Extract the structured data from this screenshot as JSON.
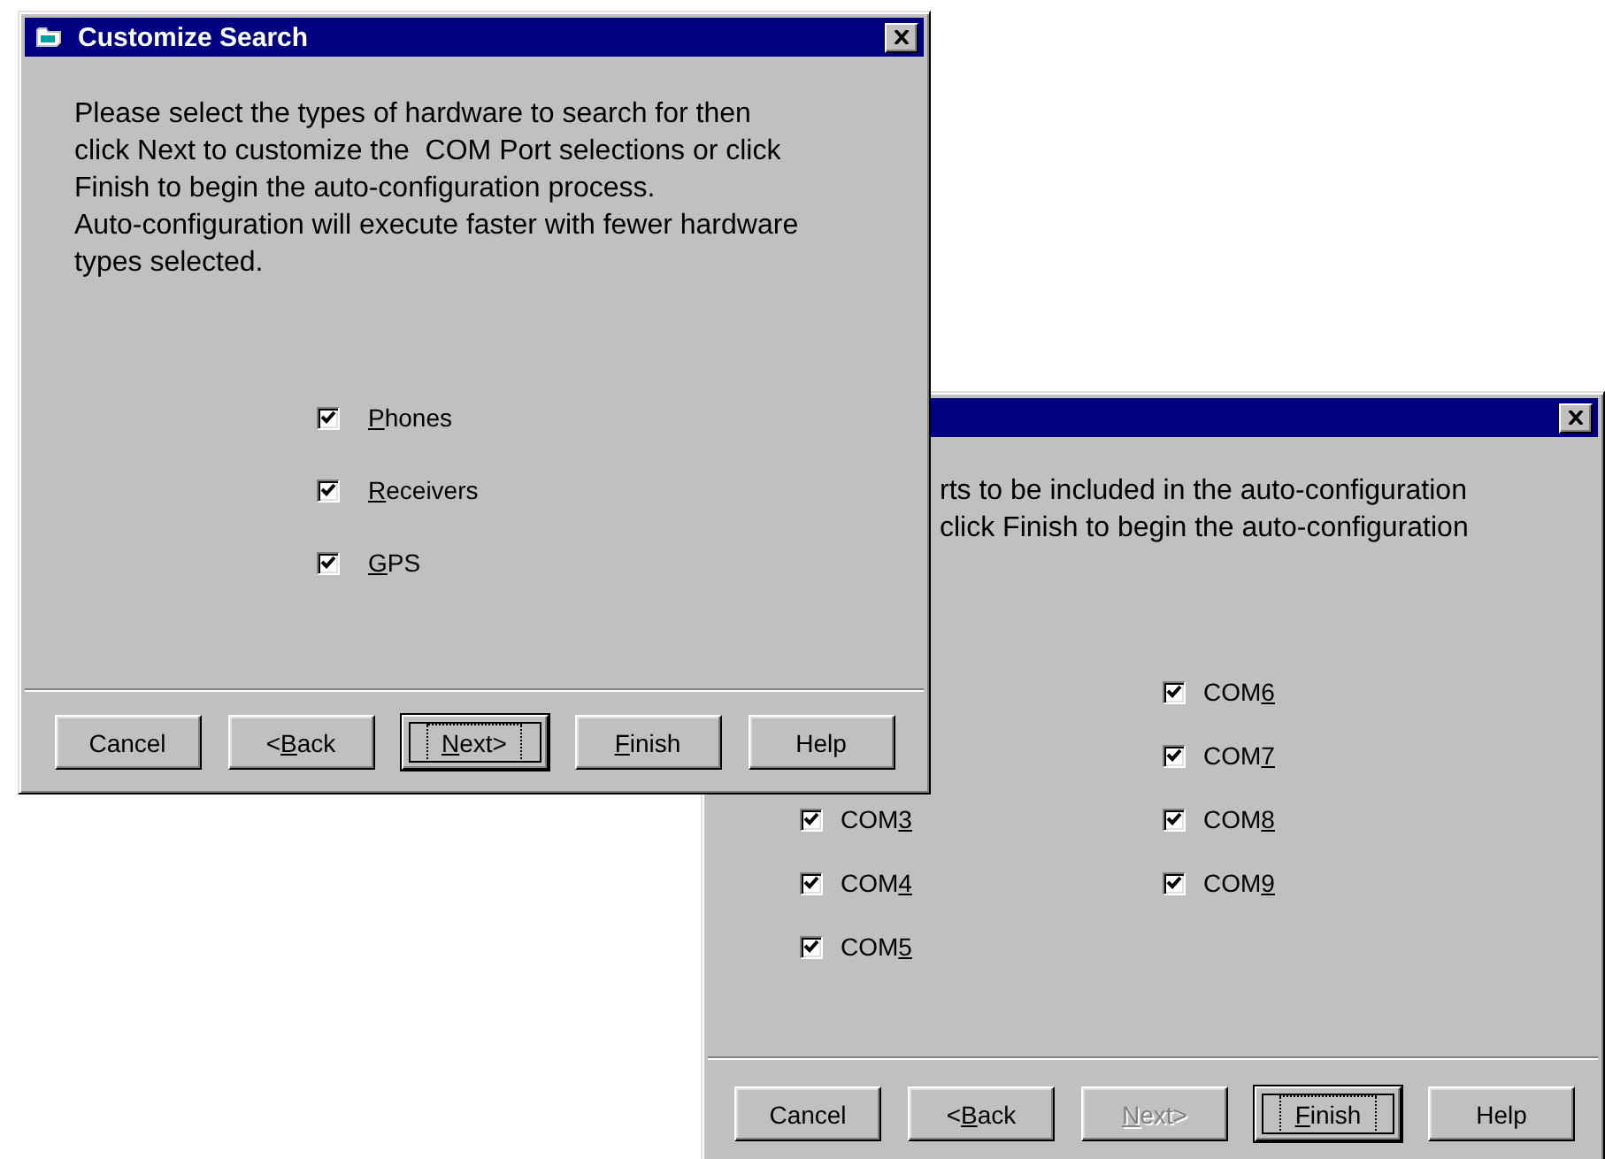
{
  "back_window": {
    "text_lines": [
      "rts to be included in the auto-configuration",
      "click Finish to begin the auto-configuration"
    ],
    "checkbox_columns": [
      {
        "items": [
          {
            "label_start": "COM",
            "access_key": "3",
            "checked": true
          },
          {
            "label_start": "COM",
            "access_key": "4",
            "checked": true
          },
          {
            "label_start": "COM",
            "access_key": "5",
            "checked": true
          }
        ]
      },
      {
        "items": [
          {
            "label_start": "COM",
            "access_key": "6",
            "checked": true
          },
          {
            "label_start": "COM",
            "access_key": "7",
            "checked": true
          },
          {
            "label_start": "COM",
            "access_key": "8",
            "checked": true
          },
          {
            "label_start": "COM",
            "access_key": "9",
            "checked": true
          }
        ]
      }
    ],
    "buttons": [
      {
        "label_end": "Cancel",
        "default": false,
        "disabled": false
      },
      {
        "label_start": "<",
        "access_key": "B",
        "label_end": "ack",
        "default": false,
        "disabled": false
      },
      {
        "access_key": "N",
        "label_end": "ext>",
        "default": false,
        "disabled": true
      },
      {
        "access_key": "F",
        "label_end": "inish",
        "default": true,
        "disabled": false
      },
      {
        "label_end": "Help",
        "default": false,
        "disabled": false
      }
    ]
  },
  "front_window": {
    "title": "Customize Search",
    "description": "Please select the types of hardware to search for then\nclick Next to customize the  COM Port selections or click\nFinish to begin the auto-configuration process.\nAuto-configuration will execute faster with fewer hardware\ntypes selected.",
    "checkboxes": [
      {
        "access_key": "P",
        "label_end": "hones",
        "checked": true
      },
      {
        "access_key": "R",
        "label_end": "eceivers",
        "checked": true
      },
      {
        "access_key": "G",
        "label_end": "PS",
        "checked": true
      }
    ],
    "buttons": [
      {
        "label_end": "Cancel",
        "default": false,
        "disabled": false
      },
      {
        "label_start": "<",
        "access_key": "B",
        "label_end": "ack",
        "default": false,
        "disabled": false
      },
      {
        "access_key": "N",
        "label_end": "ext>",
        "default": true,
        "disabled": false
      },
      {
        "access_key": "F",
        "label_end": "inish",
        "default": false,
        "disabled": false
      },
      {
        "label_end": "Help",
        "default": false,
        "disabled": false
      }
    ]
  }
}
